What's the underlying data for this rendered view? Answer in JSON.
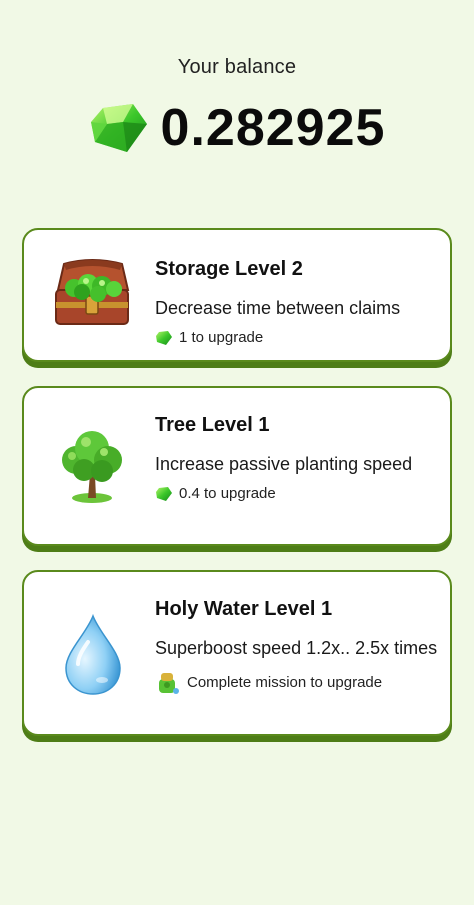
{
  "balance": {
    "label": "Your balance",
    "value": "0.282925"
  },
  "upgrades": [
    {
      "title": "Storage Level 2",
      "description": "Decrease time between claims",
      "cost": "1 to upgrade",
      "icon": "treasure-chest-icon"
    },
    {
      "title": "Tree Level 1",
      "description": "Increase passive planting speed",
      "cost": "0.4 to upgrade",
      "icon": "tree-icon"
    },
    {
      "title": "Holy Water Level 1",
      "description": "Superboost speed 1.2x.. 2.5x times",
      "cost": "Complete mission to upgrade",
      "icon": "water-drop-icon"
    }
  ],
  "colors": {
    "background": "#f1f9e6",
    "card_border": "#5a8a1c",
    "gem_green": "#38c22b"
  }
}
